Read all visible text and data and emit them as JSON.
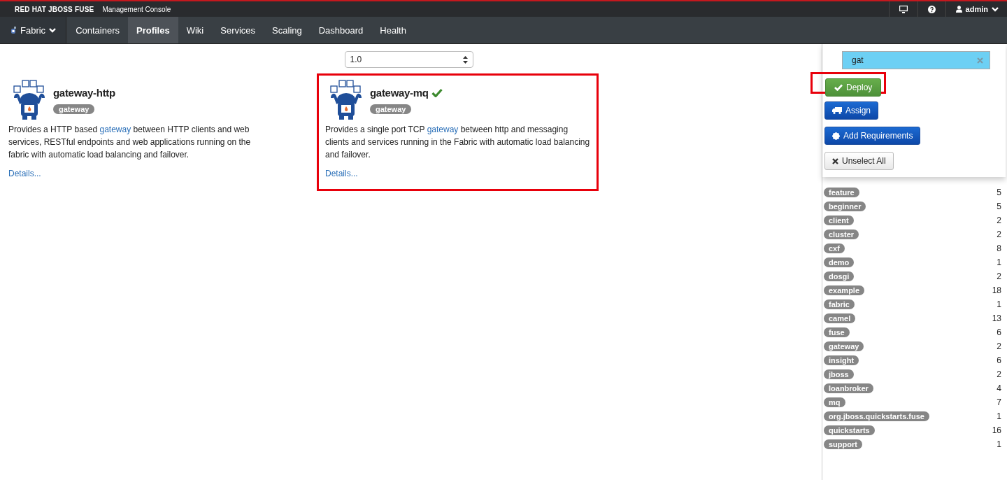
{
  "header": {
    "brand": "RED HAT JBOSS FUSE",
    "subtitle": "Management Console",
    "user": "admin"
  },
  "nav": [
    {
      "label": "Fabric",
      "selected": false,
      "kind": "dropdown"
    },
    {
      "label": "Containers",
      "selected": false,
      "kind": "tab"
    },
    {
      "label": "Profiles",
      "selected": true,
      "kind": "tab"
    },
    {
      "label": "Wiki",
      "selected": false,
      "kind": "tab"
    },
    {
      "label": "Services",
      "selected": false,
      "kind": "tab"
    },
    {
      "label": "Scaling",
      "selected": false,
      "kind": "tab"
    },
    {
      "label": "Dashboard",
      "selected": false,
      "kind": "tab"
    },
    {
      "label": "Health",
      "selected": false,
      "kind": "tab"
    }
  ],
  "version_select": {
    "value": "1.0"
  },
  "profiles": [
    {
      "name": "gateway-http",
      "selected": false,
      "highlighted": false,
      "tag": "gateway",
      "description_before": "Provides a HTTP based ",
      "link": "gateway",
      "description_after": " between HTTP clients and web services, RESTful endpoints and web applications running on the fabric with automatic load balancing and failover.",
      "details": "Details..."
    },
    {
      "name": "gateway-mq",
      "selected": true,
      "highlighted": true,
      "tag": "gateway",
      "description_before": "Provides a single port TCP ",
      "link": "gateway",
      "description_after": " between http and messaging clients and services running in the Fabric with automatic load balancing and failover.",
      "details": "Details..."
    }
  ],
  "filter": {
    "value": "gat"
  },
  "actions": [
    {
      "label": "Deploy",
      "kind": "deploy",
      "highlighted": true
    },
    {
      "label": "Assign",
      "kind": "assign",
      "highlighted": false
    },
    {
      "label": "Add Requirements",
      "kind": "requirements",
      "highlighted": false
    },
    {
      "label": "Unselect All",
      "kind": "unselect",
      "highlighted": false
    }
  ],
  "tags": [
    {
      "label": "feature",
      "count": "5"
    },
    {
      "label": "beginner",
      "count": "5"
    },
    {
      "label": "client",
      "count": "2"
    },
    {
      "label": "cluster",
      "count": "2"
    },
    {
      "label": "cxf",
      "count": "8"
    },
    {
      "label": "demo",
      "count": "1"
    },
    {
      "label": "dosgi",
      "count": "2"
    },
    {
      "label": "example",
      "count": "18"
    },
    {
      "label": "fabric",
      "count": "1"
    },
    {
      "label": "camel",
      "count": "13"
    },
    {
      "label": "fuse",
      "count": "6"
    },
    {
      "label": "gateway",
      "count": "2"
    },
    {
      "label": "insight",
      "count": "6"
    },
    {
      "label": "jboss",
      "count": "2"
    },
    {
      "label": "loanbroker",
      "count": "4"
    },
    {
      "label": "mq",
      "count": "7"
    },
    {
      "label": "org.jboss.quickstarts.fuse",
      "count": "1"
    },
    {
      "label": "quickstarts",
      "count": "16"
    },
    {
      "label": "support",
      "count": "1"
    }
  ]
}
